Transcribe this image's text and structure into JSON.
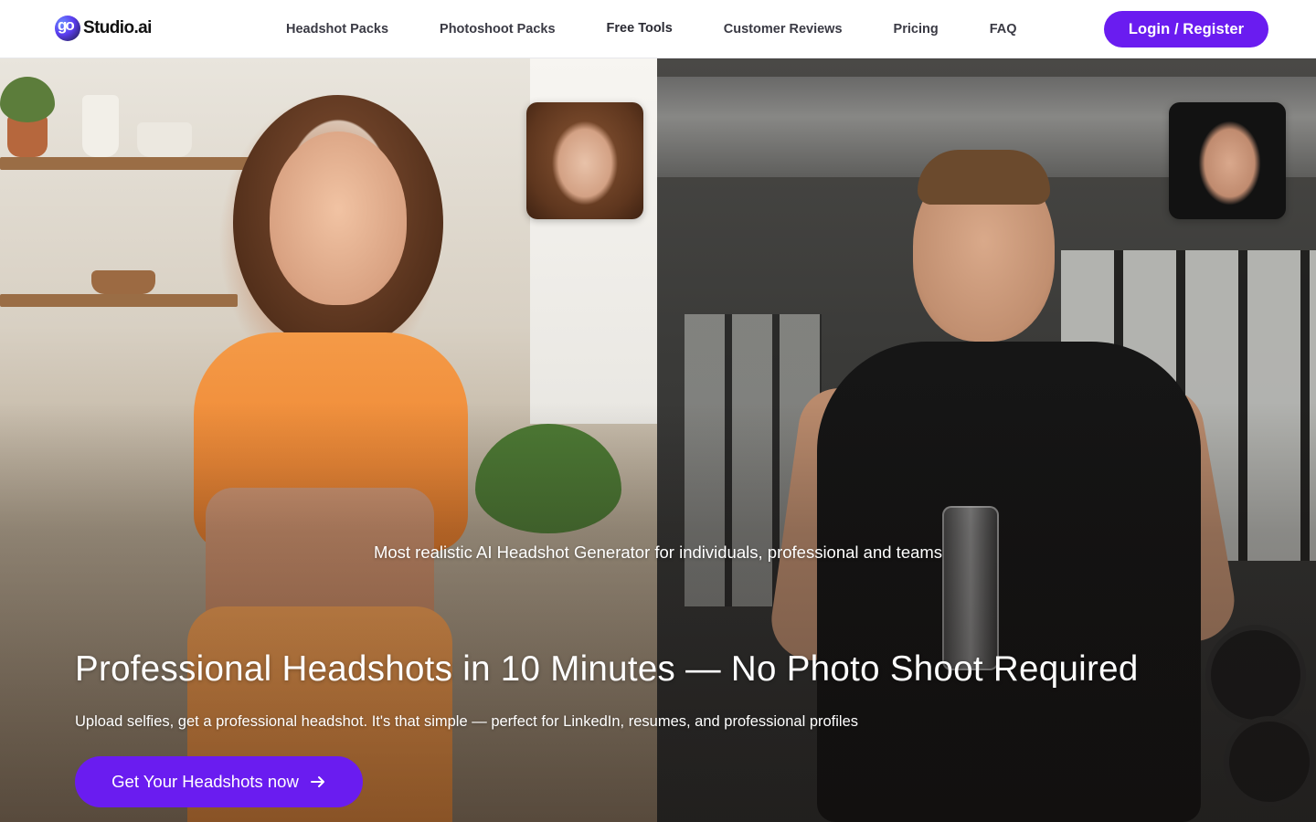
{
  "brand": {
    "name": "Studio.ai",
    "mark": "go",
    "accent_color": "#6a1cf0"
  },
  "nav": {
    "items": [
      {
        "label": "Headshot Packs"
      },
      {
        "label": "Photoshoot Packs"
      },
      {
        "label": "Free Tools"
      },
      {
        "label": "Customer Reviews"
      },
      {
        "label": "Pricing"
      },
      {
        "label": "FAQ"
      }
    ],
    "login_label": "Login / Register"
  },
  "hero": {
    "tagline": "Most realistic AI Headshot Generator for individuals, professional and teams",
    "headline": "Professional Headshots in 10 Minutes — No Photo Shoot Required",
    "subline": "Upload selfies, get a professional headshot. It's that simple — perfect for LinkedIn, resumes, and professional profiles",
    "cta_label": "Get Your Headshots now",
    "cta_icon": "arrow-right-icon"
  }
}
